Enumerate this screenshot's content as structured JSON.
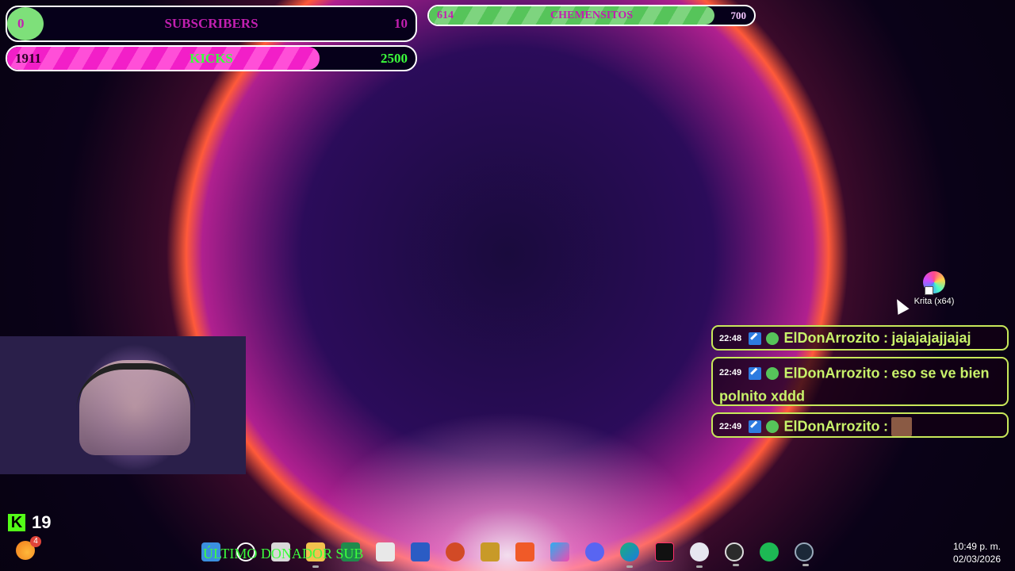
{
  "goals": {
    "subscribers": {
      "label": "SUBSCRIBERS",
      "current": "0",
      "target": "10",
      "progress": 0.0
    },
    "kicks": {
      "label": "KICKS",
      "current": "1911",
      "target": "2500",
      "progress": 0.7644
    },
    "chemensitos": {
      "label": "CHEMENSITOS",
      "current": "614",
      "target": "700",
      "progress": 0.877
    }
  },
  "desktop": {
    "krita_label": "Krita (x64)"
  },
  "chat": [
    {
      "time": "22:48",
      "user": "ElDonArrozito",
      "sep": ":",
      "message": "jajajajajjajaj"
    },
    {
      "time": "22:49",
      "user": "ElDonArrozito",
      "sep": ":",
      "message": "eso se ve bien polnito xddd"
    },
    {
      "time": "22:49",
      "user": "ElDonArrozito",
      "sep": ":",
      "message": ""
    }
  ],
  "kick_counter": {
    "value": "19",
    "logo": "K"
  },
  "taskbar": {
    "weather_badge": "4",
    "ticker": "ÚLTIMO DONADOR SUB",
    "icons": [
      "start-icon",
      "search-icon",
      "task-view-icon",
      "file-explorer-icon",
      "excel-icon",
      "store-icon",
      "word-icon",
      "powerpoint-icon",
      "folder-icon",
      "brave-icon",
      "copilot-icon",
      "discord-icon",
      "edge-icon",
      "tiktok-icon",
      "app-icon",
      "obs-icon",
      "spotify-icon",
      "steam-icon"
    ],
    "time": "10:49 p. m.",
    "date": "02/03/2026"
  }
}
